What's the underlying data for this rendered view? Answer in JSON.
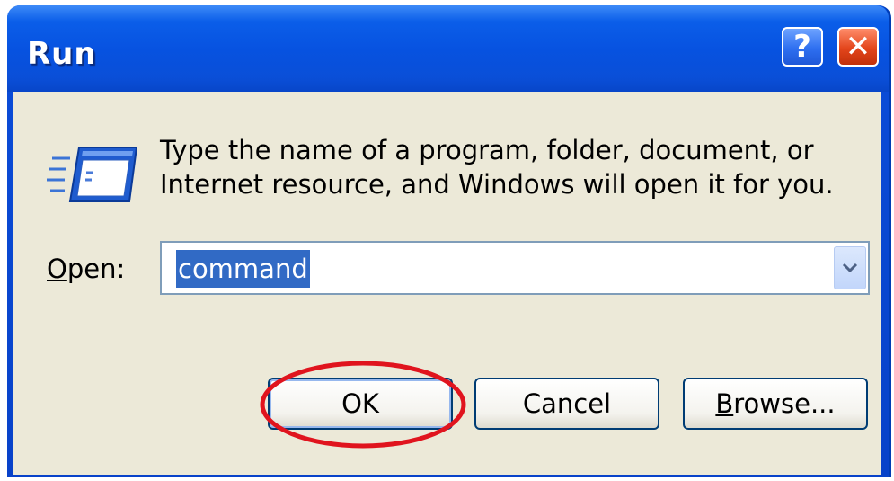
{
  "window": {
    "title": "Run",
    "help_label": "?",
    "close_label": "✕"
  },
  "dialog": {
    "description_line1": "Type the name of a program, folder, document, or",
    "description_line2": "Internet resource, and Windows will open it for you.",
    "open_label_mnemonic": "O",
    "open_label_rest": "pen:",
    "open_value": "command"
  },
  "buttons": {
    "ok": "OK",
    "cancel": "Cancel",
    "browse_mnemonic": "B",
    "browse_rest": "rowse..."
  },
  "icons": {
    "run": "run-program-icon",
    "dropdown": "chevron-down-icon",
    "annotation": "red-ellipse-highlight"
  },
  "colors": {
    "titlebar": "#0a4fd8",
    "client": "#ece9d8",
    "selection": "#316ac5",
    "close": "#e3451b",
    "annotation": "#e0141e"
  }
}
